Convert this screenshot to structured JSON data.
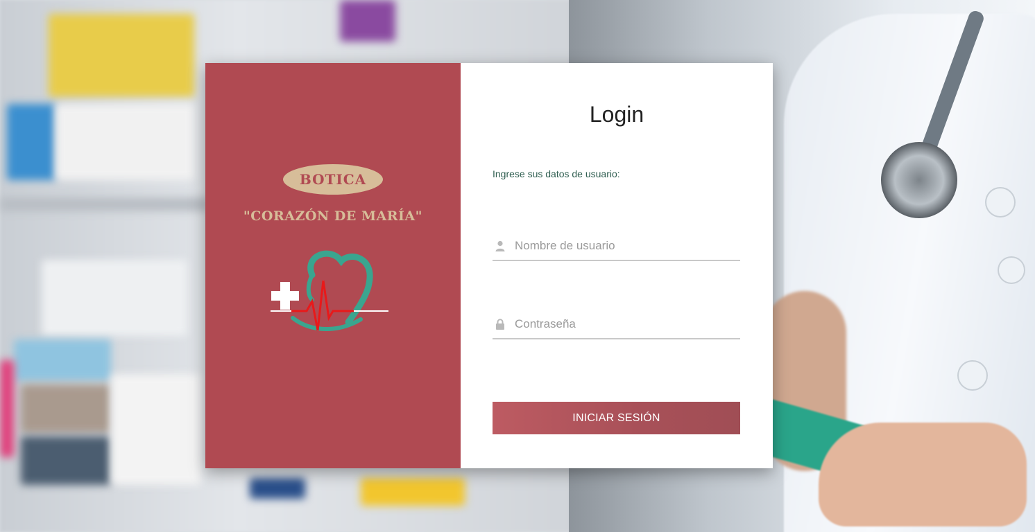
{
  "brand": {
    "tag": "BOTICA",
    "name": "\"CORAZÓN DE MARÍA\"",
    "panel_color": "#b04a52",
    "accent_color": "#d7bd99"
  },
  "login": {
    "title": "Login",
    "subtitle": "Ingrese sus datos de usuario:",
    "username": {
      "placeholder": "Nombre de usuario",
      "icon": "user-icon"
    },
    "password": {
      "placeholder": "Contraseña",
      "icon": "lock-icon"
    },
    "submit_label": "INICIAR SESIÓN"
  }
}
